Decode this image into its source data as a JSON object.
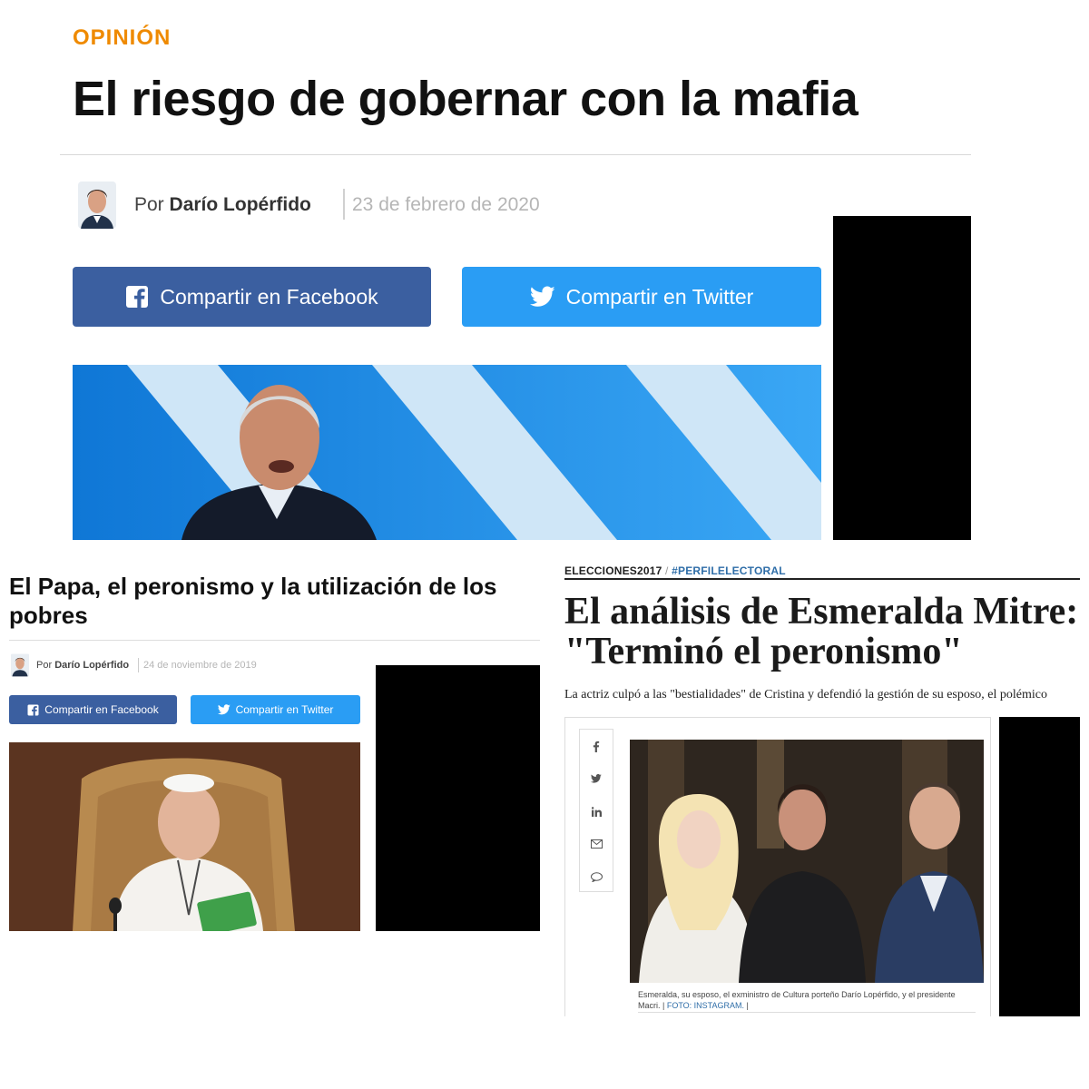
{
  "top_article": {
    "section": "OPINIÓN",
    "title": "El riesgo de gobernar con la mafia",
    "byline_prefix": "Por",
    "author": "Darío Lopérfido",
    "date": "23 de febrero de 2020",
    "share_facebook": "Compartir en Facebook",
    "share_twitter": "Compartir en Twitter"
  },
  "left_article": {
    "title": "El Papa, el peronismo y la utilización de los pobres",
    "byline_prefix": "Por",
    "author": "Darío Lopérfido",
    "date": "24 de noviembre de 2019",
    "share_facebook": "Compartir en Facebook",
    "share_twitter": "Compartir en Twitter"
  },
  "right_article": {
    "kicker_primary": "ELECCIONES2017",
    "kicker_separator": " / ",
    "kicker_secondary": "#PERFILELECTORAL",
    "title": "El análisis de Esmeralda Mitre: \"Terminó el peronismo\"",
    "subtitle": "La actriz culpó a las \"bestialidades\" de Cristina y defendió la gestión de su esposo, el polémico",
    "caption": "Esmeralda, su esposo, el exministro de Cultura porteño Darío Lopérfido, y el presidente Macri.",
    "caption_sep": " | ",
    "photo_credit": "FOTO: INSTAGRAM.",
    "caption_end": " |",
    "share_icons": [
      "facebook-icon",
      "twitter-icon",
      "linkedin-icon",
      "mail-icon",
      "comment-icon"
    ]
  },
  "colors": {
    "section_orange": "#ef8a00",
    "facebook_blue": "#3b5fa0",
    "twitter_blue": "#2a9df4",
    "link_blue": "#2f6ea8",
    "redaction": "#000000"
  }
}
